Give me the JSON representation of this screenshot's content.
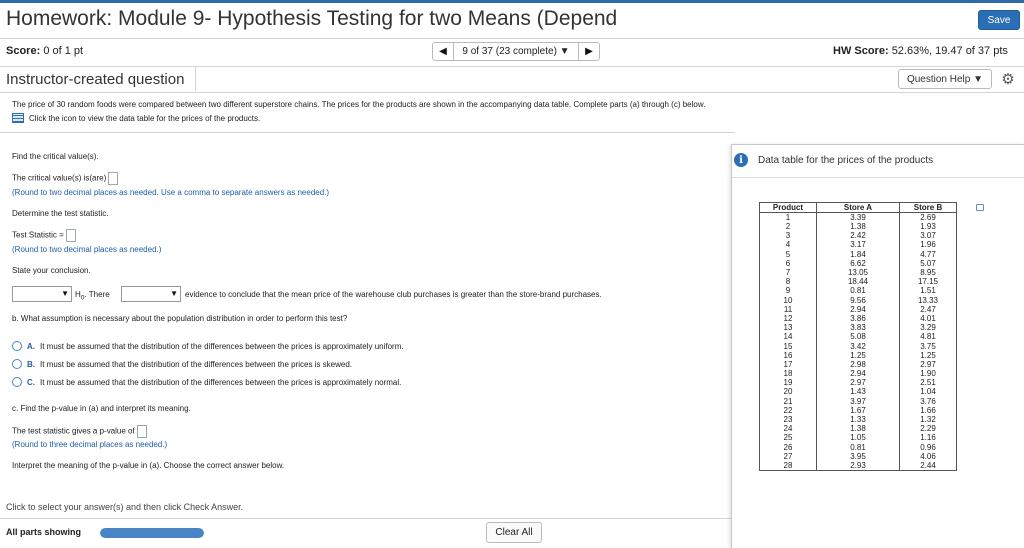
{
  "header": {
    "title": "Homework: Module 9- Hypothesis Testing for two Means (Depend",
    "save_label": "Save"
  },
  "scorebar": {
    "score_label": "Score:",
    "score_value": "0 of 1 pt",
    "nav_prev": "◀",
    "nav_selector": "9 of 37 (23 complete) ▼",
    "nav_next": "▶",
    "hw_score_label": "HW Score:",
    "hw_score_value": "52.63%, 19.47 of 37 pts"
  },
  "question_bar": {
    "instructor_label": "Instructor-created question",
    "help_label": "Question Help ▼",
    "gear_icon": "⚙"
  },
  "question": {
    "prompt": "The price of 30 random foods were compared between two different superstore chains. The prices for the products are shown in the accompanying data table. Complete parts (a) through (c) below.",
    "data_link": "Click the icon to view the data table for the prices of the products.",
    "critical_prompt": "Find the critical value(s).",
    "critical_label": "The critical value(s) is(are)",
    "critical_hint": "(Round to two decimal places as needed. Use a comma to separate answers as needed.)",
    "test_stat_prompt": "Determine the test statistic.",
    "test_stat_label": "Test Statistic =",
    "test_stat_hint": "(Round to two decimal places as needed.)",
    "conclusion_prompt": "State your conclusion.",
    "h0_prefix": "H",
    "h0_sub": "0",
    "there_label": ". There",
    "conclusion_tail": "evidence to conclude that the mean price of the warehouse club purchases is greater than the store-brand purchases.",
    "part_b_prompt": "b. What assumption is necessary about the population distribution in order to perform this test?",
    "options": [
      {
        "letter": "A.",
        "text": "It must be assumed that the distribution of the differences between the prices is approximately uniform."
      },
      {
        "letter": "B.",
        "text": "It must be assumed that the distribution of the differences between the prices is skewed."
      },
      {
        "letter": "C.",
        "text": "It must be assumed that the distribution of the differences between the prices is approximately normal."
      }
    ],
    "part_c_prompt": "c. Find the p-value in (a) and interpret its meaning.",
    "pvalue_label": "The test statistic gives a p-value of",
    "pvalue_hint": "(Round to three decimal places as needed.)",
    "interpret_prompt": "Interpret the meaning of the p-value in (a). Choose the correct answer below."
  },
  "footer": {
    "hint": "Click to select your answer(s) and then click Check Answer.",
    "all_parts_label": "All parts showing",
    "progress_fraction": 1.0,
    "clear_label": "Clear All"
  },
  "popup": {
    "info_icon": "i",
    "title": "Data table for the prices of the products",
    "headers": [
      "Product",
      "Store A",
      "Store B"
    ],
    "rows": [
      [
        "1",
        "3.39",
        "2.69"
      ],
      [
        "2",
        "1.38",
        "1.93"
      ],
      [
        "3",
        "2.42",
        "3.07"
      ],
      [
        "4",
        "3.17",
        "1.96"
      ],
      [
        "5",
        "1.84",
        "4.77"
      ],
      [
        "6",
        "6.62",
        "5.07"
      ],
      [
        "7",
        "13.05",
        "8.95"
      ],
      [
        "8",
        "18.44",
        "17.15"
      ],
      [
        "9",
        "0.81",
        "1.51"
      ],
      [
        "10",
        "9.56",
        "13.33"
      ],
      [
        "11",
        "2.94",
        "2.47"
      ],
      [
        "12",
        "3.86",
        "4.01"
      ],
      [
        "13",
        "3.83",
        "3.29"
      ],
      [
        "14",
        "5.08",
        "4.81"
      ],
      [
        "15",
        "3.42",
        "3.75"
      ],
      [
        "16",
        "1.25",
        "1.25"
      ],
      [
        "17",
        "2.98",
        "2.97"
      ],
      [
        "18",
        "2.94",
        "1.90"
      ],
      [
        "19",
        "2.97",
        "2.51"
      ],
      [
        "20",
        "1.43",
        "1.04"
      ],
      [
        "21",
        "3.97",
        "3.76"
      ],
      [
        "22",
        "1.67",
        "1.66"
      ],
      [
        "23",
        "1.33",
        "1.32"
      ],
      [
        "24",
        "1.38",
        "2.29"
      ],
      [
        "25",
        "1.05",
        "1.16"
      ],
      [
        "26",
        "0.81",
        "0.96"
      ],
      [
        "27",
        "3.95",
        "4.06"
      ],
      [
        "28",
        "2.93",
        "2.44"
      ]
    ]
  }
}
